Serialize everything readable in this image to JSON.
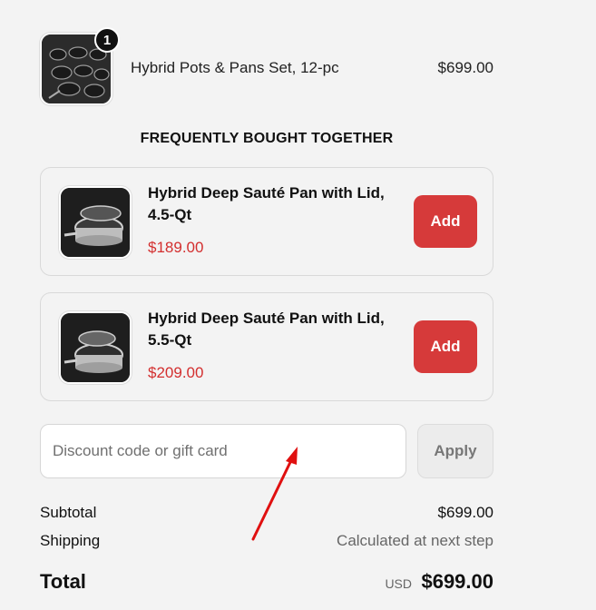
{
  "order": {
    "quantity": "1",
    "product_name": "Hybrid Pots & Pans Set, 12-pc",
    "price": "$699.00",
    "image_icon": "cookware-set-image"
  },
  "upsell": {
    "heading": "FREQUENTLY BOUGHT TOGETHER",
    "items": [
      {
        "title": "Hybrid Deep Sauté Pan with Lid, 4.5-Qt",
        "price": "$189.00",
        "button": "Add",
        "image_icon": "saute-pan-image"
      },
      {
        "title": "Hybrid Deep Sauté Pan with Lid, 5.5-Qt",
        "price": "$209.00",
        "button": "Add",
        "image_icon": "saute-pan-image"
      }
    ]
  },
  "discount": {
    "placeholder": "Discount code or gift card",
    "apply_label": "Apply"
  },
  "summary": {
    "subtotal_label": "Subtotal",
    "subtotal_value": "$699.00",
    "shipping_label": "Shipping",
    "shipping_value": "Calculated at next step",
    "total_label": "Total",
    "currency": "USD",
    "total_value": "$699.00"
  },
  "colors": {
    "accent_button": "#d63a3a",
    "price_red": "#d32f2f",
    "annotation_arrow": "#e01010"
  }
}
